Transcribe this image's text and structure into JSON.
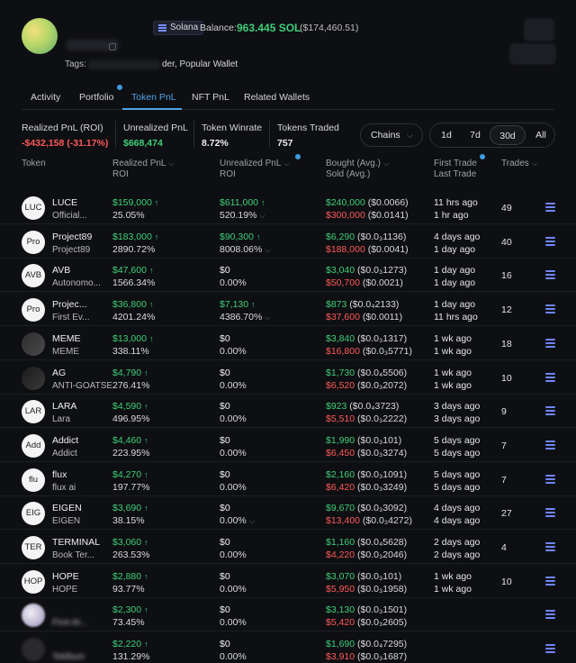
{
  "profile": {
    "chain_label": "Solana",
    "balance_label": "Balance:",
    "balance_sol": "963.445 SOL",
    "balance_usd": "($174,460.51)",
    "tags_label": "Tags:",
    "tags_value": "der, Popular Wallet"
  },
  "tabs": [
    "Activity",
    "Portfolio",
    "Token PnL",
    "NFT PnL",
    "Related Wallets"
  ],
  "stats": {
    "realized_label": "Realized PnL (ROI)",
    "realized_value": "-$432,158 (-31.17%)",
    "unrealized_label": "Unrealized PnL",
    "unrealized_value": "$668,474",
    "winrate_label": "Token Winrate",
    "winrate_value": "8.72%",
    "traded_label": "Tokens Traded",
    "traded_value": "757"
  },
  "filters": {
    "chains_label": "Chains",
    "ranges": [
      "1d",
      "7d",
      "30d",
      "All"
    ]
  },
  "columns": {
    "token": "Token",
    "realized": "Realized PnL",
    "realized_sub": "ROI",
    "unrealized": "Unrealized PnL",
    "unrealized_sub": "ROI",
    "bought": "Bought (Avg.)",
    "sold": "Sold (Avg.)",
    "first_trade": "First Trade",
    "last_trade": "Last Trade",
    "trades": "Trades"
  },
  "rows": [
    {
      "avatar": "LUC",
      "name": "LUCE",
      "sub": "Official...",
      "rpnl": "$159,000",
      "rroi": "25.05%",
      "upnl": "$611,000",
      "uroi": "520.19%",
      "u_up": true,
      "u_chev": true,
      "bought": "$240,000",
      "bought_px": "($0.0066)",
      "sold": "$300,000",
      "sold_px": "($0.0141)",
      "first": "11 hrs ago",
      "last": "1 hr ago",
      "trades": "49"
    },
    {
      "avatar": "Pro",
      "name": "Project89",
      "sub": "Project89",
      "rpnl": "$183,000",
      "rroi": "2890.72%",
      "upnl": "$90,300",
      "uroi": "8008.06%",
      "u_up": true,
      "u_chev": true,
      "bought": "$6,290",
      "bought_px": "($0.0₃1136)",
      "sold": "$188,000",
      "sold_px": "($0.0041)",
      "first": "4 days ago",
      "last": "1 day ago",
      "trades": "40"
    },
    {
      "avatar": "AVB",
      "name": "AVB",
      "sub": "Autonomo...",
      "rpnl": "$47,600",
      "rroi": "1566.34%",
      "upnl": "$0",
      "uroi": "0.00%",
      "u_up": false,
      "u_chev": false,
      "bought": "$3,040",
      "bought_px": "($0.0₃1273)",
      "sold": "$50,700",
      "sold_px": "($0.0021)",
      "first": "1 day ago",
      "last": "1 day ago",
      "trades": "16"
    },
    {
      "avatar": "Pro",
      "name": "Projec...",
      "sub": "First Ev...",
      "rpnl": "$36,800",
      "rroi": "4201.24%",
      "upnl": "$7,130",
      "uroi": "4386.70%",
      "u_up": true,
      "u_chev": true,
      "bought": "$873",
      "bought_px": "($0.0₄2133)",
      "sold": "$37,600",
      "sold_px": "($0.0011)",
      "first": "1 day ago",
      "last": "11 hrs ago",
      "trades": "12"
    },
    {
      "avatar": "",
      "avatar_style": "img-meme",
      "name": "MEME",
      "sub": "MEME",
      "rpnl": "$13,000",
      "rroi": "338.11%",
      "upnl": "$0",
      "uroi": "0.00%",
      "u_up": false,
      "u_chev": false,
      "bought": "$3,840",
      "bought_px": "($0.0₃1317)",
      "sold": "$16,800",
      "sold_px": "($0.0₃5771)",
      "first": "1 wk ago",
      "last": "1 wk ago",
      "trades": "18"
    },
    {
      "avatar": "",
      "avatar_style": "img-ag",
      "name": "AG",
      "sub": "ANTI-GOATSE",
      "rpnl": "$4,790",
      "rroi": "276.41%",
      "upnl": "$0",
      "uroi": "0.00%",
      "u_up": false,
      "u_chev": false,
      "bought": "$1,730",
      "bought_px": "($0.0₄5506)",
      "sold": "$6,520",
      "sold_px": "($0.0₃2072)",
      "first": "1 wk ago",
      "last": "1 wk ago",
      "trades": "10"
    },
    {
      "avatar": "LAR",
      "name": "LARA",
      "sub": "Lara",
      "rpnl": "$4,590",
      "rroi": "496.95%",
      "upnl": "$0",
      "uroi": "0.00%",
      "u_up": false,
      "u_chev": false,
      "bought": "$923",
      "bought_px": "($0.0₄3723)",
      "sold": "$5,510",
      "sold_px": "($0.0₃2222)",
      "first": "3 days ago",
      "last": "3 days ago",
      "trades": "9"
    },
    {
      "avatar": "Add",
      "name": "Addict",
      "sub": "Addict",
      "rpnl": "$4,460",
      "rroi": "223.95%",
      "upnl": "$0",
      "uroi": "0.00%",
      "u_up": false,
      "u_chev": false,
      "bought": "$1,990",
      "bought_px": "($0.0₃101)",
      "sold": "$6,450",
      "sold_px": "($0.0₃3274)",
      "first": "5 days ago",
      "last": "5 days ago",
      "trades": "7"
    },
    {
      "avatar": "flu",
      "name": "flux",
      "sub": "flux ai",
      "rpnl": "$4,270",
      "rroi": "197.77%",
      "upnl": "$0",
      "uroi": "0.00%",
      "u_up": false,
      "u_chev": false,
      "bought": "$2,160",
      "bought_px": "($0.0₃1091)",
      "sold": "$6,420",
      "sold_px": "($0.0₃3249)",
      "first": "5 days ago",
      "last": "5 days ago",
      "trades": "7"
    },
    {
      "avatar": "EIG",
      "name": "EIGEN",
      "sub": "EIGEN",
      "rpnl": "$3,690",
      "rroi": "38.15%",
      "upnl": "$0",
      "uroi": "0.00%",
      "u_up": false,
      "u_chev": true,
      "bought": "$9,670",
      "bought_px": "($0.0₃3092)",
      "sold": "$13,400",
      "sold_px": "($0.0₃4272)",
      "first": "4 days ago",
      "last": "4 days ago",
      "trades": "27"
    },
    {
      "avatar": "TER",
      "name": "TERMINAL",
      "sub": "Book Ter...",
      "rpnl": "$3,060",
      "rroi": "263.53%",
      "upnl": "$0",
      "uroi": "0.00%",
      "u_up": false,
      "u_chev": false,
      "bought": "$1,160",
      "bought_px": "($0.0₄5628)",
      "sold": "$4,220",
      "sold_px": "($0.0₃2046)",
      "first": "2 days ago",
      "last": "2 days ago",
      "trades": "4"
    },
    {
      "avatar": "HOP",
      "name": "HOPE",
      "sub": "HOPE",
      "rpnl": "$2,880",
      "rroi": "93.77%",
      "upnl": "$0",
      "uroi": "0.00%",
      "u_up": false,
      "u_chev": false,
      "bought": "$3,070",
      "bought_px": "($0.0₃101)",
      "sold": "$5,950",
      "sold_px": "($0.0₃1958)",
      "first": "1 wk ago",
      "last": "1 wk ago",
      "trades": "10"
    },
    {
      "avatar": "",
      "avatar_style": "img-first",
      "name": "",
      "sub": "First AI...",
      "sub_blur": true,
      "rpnl": "$2,300",
      "rroi": "73.45%",
      "upnl": "$0",
      "uroi": "0.00%",
      "u_up": false,
      "u_chev": false,
      "bought": "$3,130",
      "bought_px": "($0.0₃1501)",
      "sold": "$5,420",
      "sold_px": "($0.0₃2605)",
      "first": "",
      "last": "",
      "trades": "",
      "blur_right": true
    },
    {
      "avatar": "",
      "avatar_style": "img-tek",
      "name": "",
      "sub": "Tekllium",
      "sub_blur": true,
      "rpnl": "$2,220",
      "rroi": "131.29%",
      "upnl": "$0",
      "uroi": "0.00%",
      "u_up": false,
      "u_chev": false,
      "bought": "$1,690",
      "bought_px": "($0.0₄7295)",
      "sold": "$3,910",
      "sold_px": "($0.0₃1687)",
      "first": "",
      "last": "",
      "trades": "",
      "blur_right": true
    }
  ]
}
